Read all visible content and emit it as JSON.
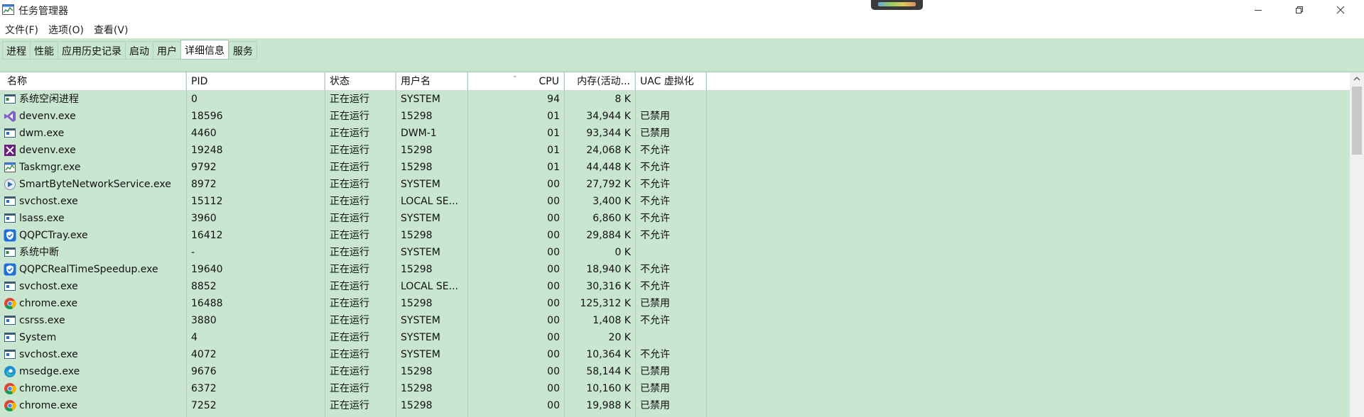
{
  "window": {
    "title": "任务管理器",
    "icon": "taskmgr-icon"
  },
  "menu": [
    {
      "label": "文件(F)"
    },
    {
      "label": "选项(O)"
    },
    {
      "label": "查看(V)"
    }
  ],
  "tabs": [
    {
      "label": "进程",
      "active": false
    },
    {
      "label": "性能",
      "active": false
    },
    {
      "label": "应用历史记录",
      "active": false
    },
    {
      "label": "启动",
      "active": false
    },
    {
      "label": "用户",
      "active": false
    },
    {
      "label": "详细信息",
      "active": true
    },
    {
      "label": "服务",
      "active": false
    }
  ],
  "columns": {
    "name": "名称",
    "pid": "PID",
    "status": "状态",
    "user": "用户名",
    "cpu": "CPU",
    "memory": "内存(活动...",
    "uac": "UAC 虚拟化"
  },
  "rows": [
    {
      "icon": "system-process-icon",
      "name": "系统空闲进程",
      "pid": "0",
      "status": "正在运行",
      "user": "SYSTEM",
      "cpu": "94",
      "memory": "8 K",
      "uac": ""
    },
    {
      "icon": "visual-studio-icon",
      "name": "devenv.exe",
      "pid": "18596",
      "status": "正在运行",
      "user": "15298",
      "cpu": "01",
      "memory": "34,944 K",
      "uac": "已禁用"
    },
    {
      "icon": "window-process-icon",
      "name": "dwm.exe",
      "pid": "4460",
      "status": "正在运行",
      "user": "DWM-1",
      "cpu": "01",
      "memory": "93,344 K",
      "uac": "已禁用"
    },
    {
      "icon": "visual-studio-alt-icon",
      "name": "devenv.exe",
      "pid": "19248",
      "status": "正在运行",
      "user": "15298",
      "cpu": "01",
      "memory": "24,068 K",
      "uac": "不允许"
    },
    {
      "icon": "taskmgr-icon",
      "name": "Taskmgr.exe",
      "pid": "9792",
      "status": "正在运行",
      "user": "15298",
      "cpu": "01",
      "memory": "44,448 K",
      "uac": "不允许"
    },
    {
      "icon": "smartbyte-icon",
      "name": "SmartByteNetworkService.exe",
      "pid": "8972",
      "status": "正在运行",
      "user": "SYSTEM",
      "cpu": "00",
      "memory": "27,792 K",
      "uac": "不允许"
    },
    {
      "icon": "window-process-icon",
      "name": "svchost.exe",
      "pid": "15112",
      "status": "正在运行",
      "user": "LOCAL SE...",
      "cpu": "00",
      "memory": "3,400 K",
      "uac": "不允许"
    },
    {
      "icon": "window-process-icon",
      "name": "lsass.exe",
      "pid": "3960",
      "status": "正在运行",
      "user": "SYSTEM",
      "cpu": "00",
      "memory": "6,860 K",
      "uac": "不允许"
    },
    {
      "icon": "qq-shield-icon",
      "name": "QQPCTray.exe",
      "pid": "16412",
      "status": "正在运行",
      "user": "15298",
      "cpu": "00",
      "memory": "29,884 K",
      "uac": "不允许"
    },
    {
      "icon": "system-process-icon",
      "name": "系统中断",
      "pid": "-",
      "status": "正在运行",
      "user": "SYSTEM",
      "cpu": "00",
      "memory": "0 K",
      "uac": ""
    },
    {
      "icon": "qq-shield-icon",
      "name": "QQPCRealTimeSpeedup.exe",
      "pid": "19640",
      "status": "正在运行",
      "user": "15298",
      "cpu": "00",
      "memory": "18,940 K",
      "uac": "不允许"
    },
    {
      "icon": "window-process-icon",
      "name": "svchost.exe",
      "pid": "8852",
      "status": "正在运行",
      "user": "LOCAL SE...",
      "cpu": "00",
      "memory": "30,316 K",
      "uac": "不允许"
    },
    {
      "icon": "chrome-icon",
      "name": "chrome.exe",
      "pid": "16488",
      "status": "正在运行",
      "user": "15298",
      "cpu": "00",
      "memory": "125,312 K",
      "uac": "已禁用"
    },
    {
      "icon": "window-process-icon",
      "name": "csrss.exe",
      "pid": "3880",
      "status": "正在运行",
      "user": "SYSTEM",
      "cpu": "00",
      "memory": "1,408 K",
      "uac": "不允许"
    },
    {
      "icon": "window-process-icon",
      "name": "System",
      "pid": "4",
      "status": "正在运行",
      "user": "SYSTEM",
      "cpu": "00",
      "memory": "20 K",
      "uac": ""
    },
    {
      "icon": "window-process-icon",
      "name": "svchost.exe",
      "pid": "4072",
      "status": "正在运行",
      "user": "SYSTEM",
      "cpu": "00",
      "memory": "10,364 K",
      "uac": "不允许"
    },
    {
      "icon": "edge-icon",
      "name": "msedge.exe",
      "pid": "9676",
      "status": "正在运行",
      "user": "15298",
      "cpu": "00",
      "memory": "58,144 K",
      "uac": "已禁用"
    },
    {
      "icon": "chrome-icon",
      "name": "chrome.exe",
      "pid": "6372",
      "status": "正在运行",
      "user": "15298",
      "cpu": "00",
      "memory": "10,160 K",
      "uac": "已禁用"
    },
    {
      "icon": "chrome-icon",
      "name": "chrome.exe",
      "pid": "7252",
      "status": "正在运行",
      "user": "15298",
      "cpu": "00",
      "memory": "19,988 K",
      "uac": "已禁用"
    }
  ],
  "colors": {
    "selection_green": "#c9e6d0",
    "accent_blue": "#1e6fd9"
  }
}
